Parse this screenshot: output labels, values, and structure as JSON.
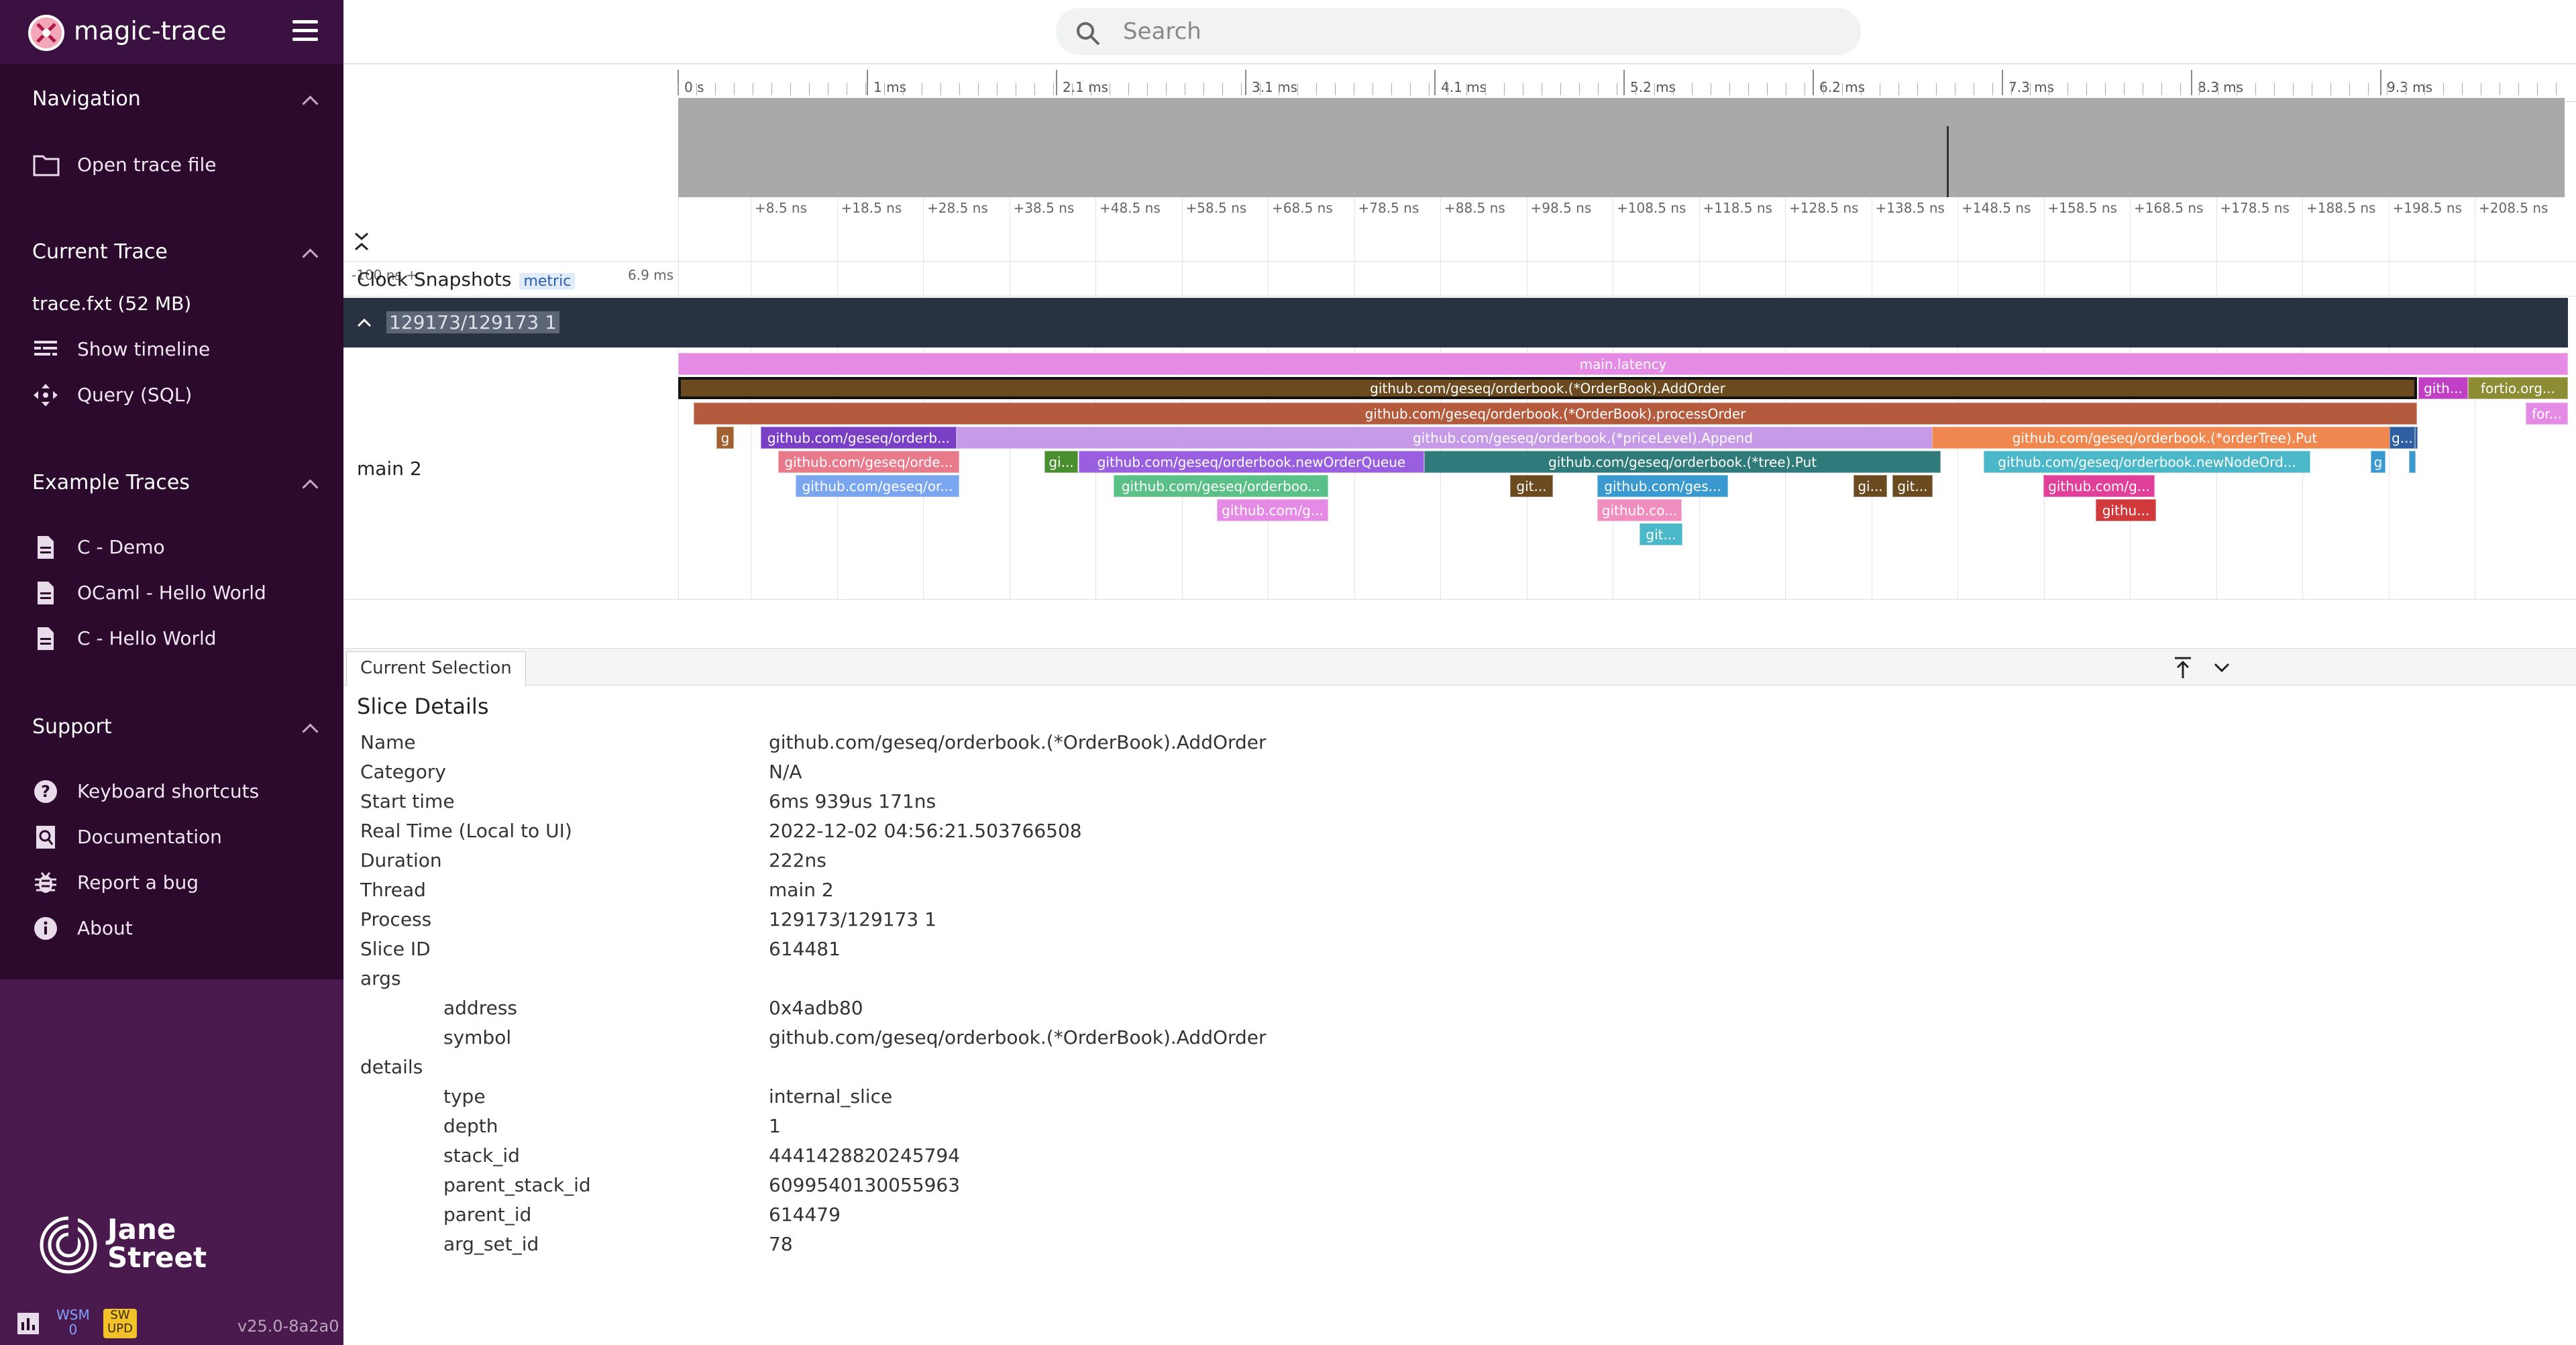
{
  "app": {
    "title": "magic-trace"
  },
  "search": {
    "placeholder": "Search"
  },
  "sidebar": {
    "sections": [
      {
        "title": "Navigation",
        "items": [
          {
            "label": "Open trace file",
            "icon": "folder-icon"
          }
        ]
      },
      {
        "title": "Current Trace",
        "trace_file": "trace.fxt (52 MB)",
        "items": [
          {
            "label": "Show timeline",
            "icon": "timeline-icon"
          },
          {
            "label": "Query (SQL)",
            "icon": "query-icon"
          }
        ]
      },
      {
        "title": "Example Traces",
        "items": [
          {
            "label": "C - Demo",
            "icon": "file-icon"
          },
          {
            "label": "OCaml - Hello World",
            "icon": "file-icon"
          },
          {
            "label": "C - Hello World",
            "icon": "file-icon"
          }
        ]
      },
      {
        "title": "Support",
        "items": [
          {
            "label": "Keyboard shortcuts",
            "icon": "help-icon"
          },
          {
            "label": "Documentation",
            "icon": "doc-search-icon"
          },
          {
            "label": "Report a bug",
            "icon": "bug-icon"
          },
          {
            "label": "About",
            "icon": "info-icon"
          }
        ]
      }
    ],
    "brand": {
      "line1": "Jane",
      "line2": "Street"
    },
    "status": {
      "wsm_label": "WSM",
      "wsm_value": "0",
      "sw_line1": "SW",
      "sw_line2": "UPD",
      "version": "v25.0-8a2a0"
    }
  },
  "timeline": {
    "overview_ticks": [
      "0 s",
      "1 ms",
      "2.1 ms",
      "3.1 ms",
      "4.1 ms",
      "5.2 ms",
      "6.2 ms",
      "7.3 ms",
      "8.3 ms",
      "9.3 ms"
    ],
    "rel_start": "-100 ns +",
    "rel_end": "6.9 ms",
    "rel_ticks": [
      "+8.5 ns",
      "+18.5 ns",
      "+28.5 ns",
      "+38.5 ns",
      "+48.5 ns",
      "+58.5 ns",
      "+68.5 ns",
      "+78.5 ns",
      "+88.5 ns",
      "+98.5 ns",
      "+108.5 ns",
      "+118.5 ns",
      "+128.5 ns",
      "+138.5 ns",
      "+148.5 ns",
      "+158.5 ns",
      "+168.5 ns",
      "+178.5 ns",
      "+188.5 ns",
      "+198.5 ns",
      "+208.5 ns"
    ],
    "clock_track": {
      "title": "Clock Snapshots",
      "badge": "metric"
    },
    "process": {
      "name": "129173/129173 1"
    },
    "thread": {
      "name": "main 2"
    },
    "slices": [
      {
        "label": "main.latency",
        "color": "#e58be6"
      },
      {
        "label": "github.com/geseq/orderbook.(*OrderBook).AddOrder",
        "color": "#6b4a1f",
        "selected": true
      },
      {
        "label": "gith...",
        "color": "#c13fc4"
      },
      {
        "label": "fortio.org...",
        "color": "#8c8c34"
      },
      {
        "label": "github.com/geseq/orderbook.(*OrderBook).processOrder",
        "color": "#b35b3c"
      },
      {
        "label": "for...",
        "color": "#e58be6"
      },
      {
        "label": "g",
        "color": "#a0602f"
      },
      {
        "label": "github.com/geseq/orderb...",
        "color": "#7a3fc4"
      },
      {
        "label": "github.com/geseq/orderbook.(*priceLevel).Append",
        "color": "#c79ae8"
      },
      {
        "label": "github.com/geseq/orderbook.(*orderTree).Put",
        "color": "#f0874f"
      },
      {
        "label": "g...",
        "color": "#2f5fa0"
      },
      {
        "label": "github.com/geseq/orde...",
        "color": "#e87a8c"
      },
      {
        "label": "gi...",
        "color": "#4a8f2f"
      },
      {
        "label": "github.com/geseq/orderbook.newOrderQueue",
        "color": "#9a5fe0"
      },
      {
        "label": "github.com/geseq/orderbook.(*tree).Put",
        "color": "#2f7a7a"
      },
      {
        "label": "github.com/geseq/orderbook.newNodeOrd...",
        "color": "#4ab8c8"
      },
      {
        "label": "g",
        "color": "#3a9ad0"
      },
      {
        "label": "github.com/geseq/or...",
        "color": "#7aa6f0"
      },
      {
        "label": "github.com/geseq/orderboo...",
        "color": "#5ac088"
      },
      {
        "label": "git...",
        "color": "#6b4a1f"
      },
      {
        "label": "github.com/ges...",
        "color": "#3a9ad0"
      },
      {
        "label": "gi...",
        "color": "#6b4a1f"
      },
      {
        "label": "git...",
        "color": "#6b4a1f"
      },
      {
        "label": "github.com/g...",
        "color": "#e0409a"
      },
      {
        "label": "github.com/g...",
        "color": "#e58be6"
      },
      {
        "label": "github.co...",
        "color": "#f08ec0"
      },
      {
        "label": "githu...",
        "color": "#d03a3a"
      },
      {
        "label": "git...",
        "color": "#4ab8c8"
      }
    ]
  },
  "details": {
    "tab": "Current Selection",
    "heading": "Slice Details",
    "rows": [
      {
        "k": "Name",
        "v": "github.com/geseq/orderbook.(*OrderBook).AddOrder"
      },
      {
        "k": "Category",
        "v": "N/A"
      },
      {
        "k": "Start time",
        "v": "6ms 939us 171ns"
      },
      {
        "k": "Real Time (Local to UI)",
        "v": "2022-12-02 04:56:21.503766508"
      },
      {
        "k": "Duration",
        "v": "222ns"
      },
      {
        "k": "Thread",
        "v": "main 2"
      },
      {
        "k": "Process",
        "v": "129173/129173 1"
      },
      {
        "k": "Slice ID",
        "v": "614481"
      }
    ],
    "args_label": "args",
    "args": [
      {
        "k": "address",
        "v": "0x4adb80"
      },
      {
        "k": "symbol",
        "v": "github.com/geseq/orderbook.(*OrderBook).AddOrder"
      }
    ],
    "details_label": "details",
    "details": [
      {
        "k": "type",
        "v": "internal_slice"
      },
      {
        "k": "depth",
        "v": "1"
      },
      {
        "k": "stack_id",
        "v": "4441428820245794"
      },
      {
        "k": "parent_stack_id",
        "v": "6099540130055963"
      },
      {
        "k": "parent_id",
        "v": "614479"
      },
      {
        "k": "arg_set_id",
        "v": "78"
      }
    ]
  }
}
